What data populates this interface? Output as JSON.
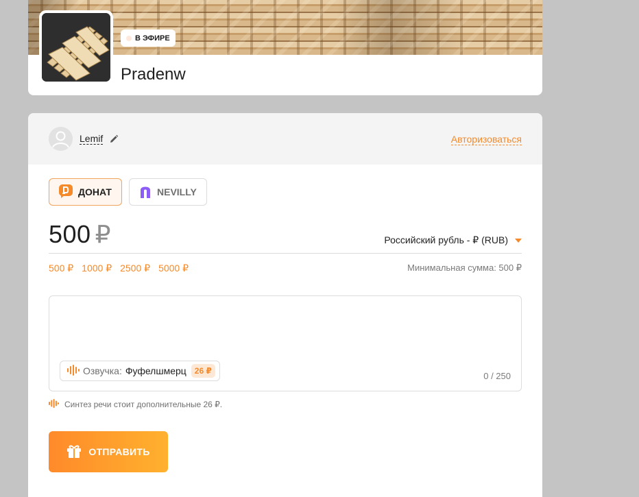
{
  "profile": {
    "live_badge": "В ЭФИРЕ",
    "channel_name": "Pradenw",
    "icons": [
      "banner-pallets-image",
      "pallet-avatar-image",
      "live-dot-icon"
    ]
  },
  "user_bar": {
    "username": "Lemif",
    "login_link": "Авторизоваться",
    "icons": [
      "user-avatar-icon",
      "pencil-icon"
    ]
  },
  "tabs": [
    {
      "label": "ДОНАТ",
      "icon": "donat-logo-icon",
      "active": true
    },
    {
      "label": "NEVILLY",
      "icon": "nevilly-logo-icon",
      "active": false
    }
  ],
  "amount": {
    "value": "500",
    "currency_symbol": "₽",
    "currency_select": "Российский рубль - ₽ (RUB)",
    "presets": [
      "500 ₽",
      "1000 ₽",
      "2500 ₽",
      "5000 ₽"
    ],
    "min_sum": "Минимальная сумма: 500 ₽"
  },
  "message": {
    "voice_label": "Озвучка:",
    "voice_name": "Фуфелшмерц",
    "voice_price": "26 ₽",
    "counter": "0 / 250"
  },
  "synth_note": "Синтез речи стоит дополнительные 26 ₽.",
  "send_label": "ОТПРАВИТЬ",
  "colors": {
    "accent": "#f48a2a",
    "button_gradient_start": "#ff8a2a",
    "button_gradient_end": "#ffb12e",
    "page_background": "#c4c4c4"
  }
}
